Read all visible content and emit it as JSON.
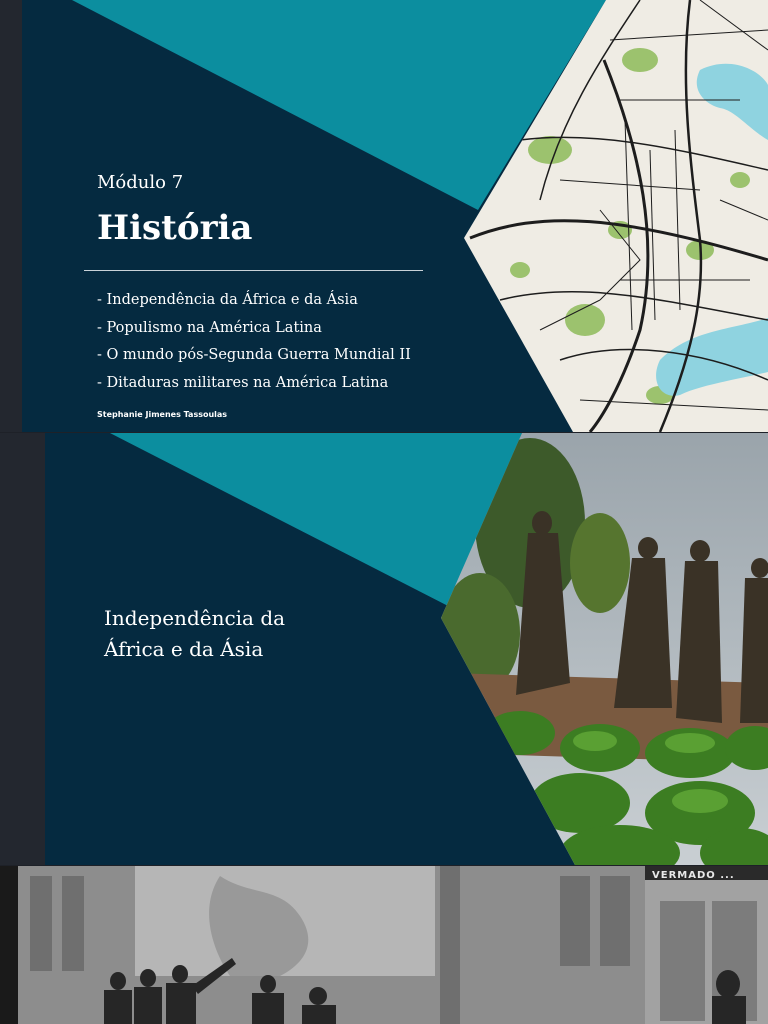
{
  "cover": {
    "module_label": "Módulo 7",
    "title": "História",
    "topics": [
      "- Independência da África e da Ásia",
      "- Populismo na América Latina",
      "- O mundo pós-Segunda Guerra Mundial II",
      "- Ditaduras militares na América Latina"
    ],
    "author": "Stephanie Jimenes Tassoulas"
  },
  "chapter": {
    "title_line1": "Independência da",
    "title_line2": "África e da Ásia"
  },
  "engraving": {
    "sign_text": "VERMADO ..."
  },
  "colors": {
    "navy": "#052a40",
    "teal": "#0c8e9f",
    "side_strip": "#23272f"
  }
}
